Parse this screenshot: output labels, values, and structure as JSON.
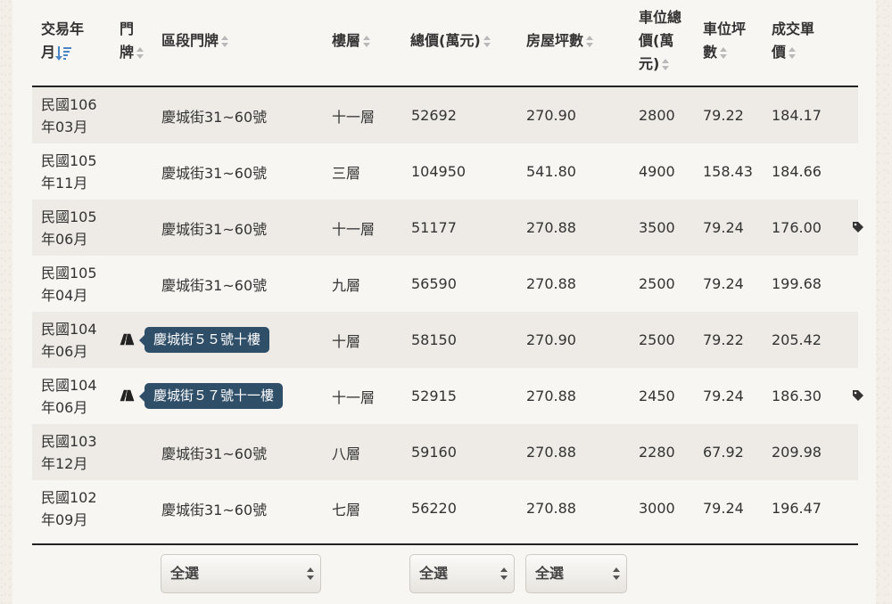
{
  "headers": {
    "date": [
      "交易年",
      "月"
    ],
    "door": [
      "門",
      "牌"
    ],
    "address": "區段門牌",
    "floor": "樓層",
    "total_price": "總價(萬元)",
    "area": "房屋坪數",
    "parking_price": [
      "車位總",
      "價(萬",
      "元)"
    ],
    "parking_area": [
      "車位坪",
      "數"
    ],
    "unit_price": [
      "成交單",
      "價"
    ]
  },
  "rows": [
    {
      "date1": "民國106",
      "date2": "年03月",
      "address": "慶城街31~60號",
      "floor": "十一層",
      "total": "52692",
      "area": "270.90",
      "parking": "2800",
      "parking_area": "79.22",
      "unit": "184.17",
      "tag": false,
      "map": false,
      "tooltip": ""
    },
    {
      "date1": "民國105",
      "date2": "年11月",
      "address": "慶城街31~60號",
      "floor": "三層",
      "total": "104950",
      "area": "541.80",
      "parking": "4900",
      "parking_area": "158.43",
      "unit": "184.66",
      "tag": false,
      "map": false,
      "tooltip": ""
    },
    {
      "date1": "民國105",
      "date2": "年06月",
      "address": "慶城街31~60號",
      "floor": "十一層",
      "total": "51177",
      "area": "270.88",
      "parking": "3500",
      "parking_area": "79.24",
      "unit": "176.00",
      "tag": true,
      "map": false,
      "tooltip": ""
    },
    {
      "date1": "民國105",
      "date2": "年04月",
      "address": "慶城街31~60號",
      "floor": "九層",
      "total": "56590",
      "area": "270.88",
      "parking": "2500",
      "parking_area": "79.24",
      "unit": "199.68",
      "tag": false,
      "map": false,
      "tooltip": ""
    },
    {
      "date1": "民國104",
      "date2": "年06月",
      "address": "",
      "floor": "十層",
      "total": "58150",
      "area": "270.90",
      "parking": "2500",
      "parking_area": "79.22",
      "unit": "205.42",
      "tag": false,
      "map": true,
      "tooltip": "慶城街５５號十樓"
    },
    {
      "date1": "民國104",
      "date2": "年06月",
      "address": "",
      "floor": "十一層",
      "total": "52915",
      "area": "270.88",
      "parking": "2450",
      "parking_area": "79.24",
      "unit": "186.30",
      "tag": true,
      "map": true,
      "tooltip": "慶城街５７號十一樓"
    },
    {
      "date1": "民國103",
      "date2": "年12月",
      "address": "慶城街31~60號",
      "floor": "八層",
      "total": "59160",
      "area": "270.88",
      "parking": "2280",
      "parking_area": "67.92",
      "unit": "209.98",
      "tag": false,
      "map": false,
      "tooltip": ""
    },
    {
      "date1": "民國102",
      "date2": "年09月",
      "address": "慶城街31~60號",
      "floor": "七層",
      "total": "56220",
      "area": "270.88",
      "parking": "3000",
      "parking_area": "79.24",
      "unit": "196.47",
      "tag": false,
      "map": false,
      "tooltip": ""
    }
  ],
  "filters": {
    "address": "全選",
    "total_price": "全選",
    "area": "全選"
  },
  "icons": {
    "sort_active": "sort-descending-icon",
    "sort": "sort-icon",
    "tag": "tag-icon",
    "map": "map-icon"
  }
}
